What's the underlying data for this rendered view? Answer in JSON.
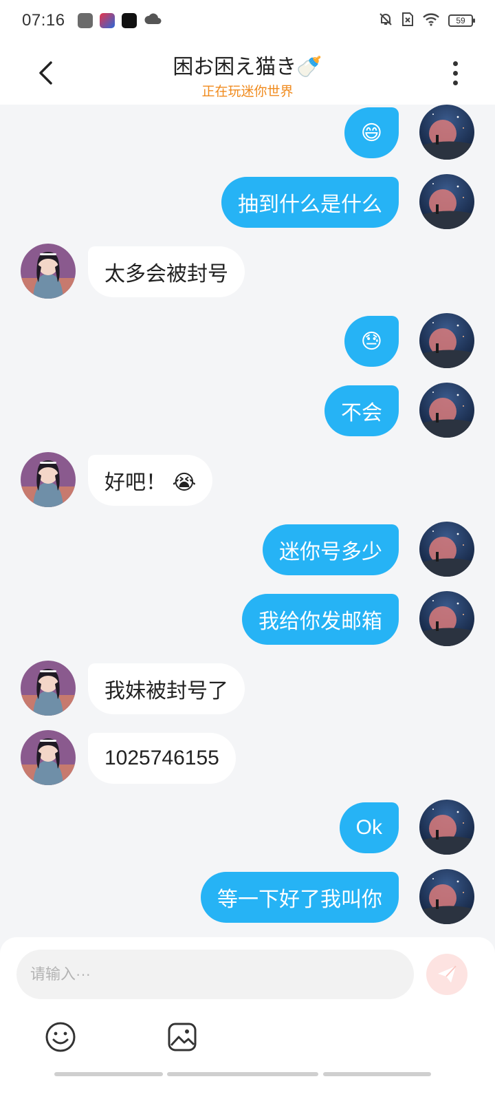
{
  "status_bar": {
    "time": "07:16",
    "battery": "59",
    "icons": [
      "app-icon-1",
      "app-icon-2",
      "tiktok-icon",
      "cloud-icon",
      "mute-bell-icon",
      "sim-off-icon",
      "wifi-icon",
      "battery-icon"
    ]
  },
  "header": {
    "title": "困お困え猫き🍼",
    "subtitle": "正在玩迷你世界",
    "back_icon": "chevron-left-icon",
    "more_icon": "more-vertical-icon"
  },
  "messages": [
    {
      "side": "me",
      "text": "😄"
    },
    {
      "side": "me",
      "text": "抽到什么是什么"
    },
    {
      "side": "them",
      "text": "太多会被封号"
    },
    {
      "side": "me",
      "text": "😓"
    },
    {
      "side": "me",
      "text": "不会"
    },
    {
      "side": "them",
      "text": "好吧！ 😭"
    },
    {
      "side": "me",
      "text": "迷你号多少"
    },
    {
      "side": "me",
      "text": "我给你发邮箱"
    },
    {
      "side": "them",
      "text": "我妹被封号了"
    },
    {
      "side": "them",
      "text": "1025746155"
    },
    {
      "side": "me",
      "text": "Ok"
    },
    {
      "side": "me",
      "text": "等一下好了我叫你"
    }
  ],
  "input": {
    "placeholder": "请输入···",
    "value": ""
  },
  "toolbar": {
    "emoji_icon": "smiley-icon",
    "image_icon": "image-icon",
    "send_icon": "send-icon"
  },
  "colors": {
    "my_bubble": "#26b3f5",
    "their_bubble": "#ffffff",
    "subtitle": "#f08a1c",
    "background": "#f4f5f7"
  }
}
